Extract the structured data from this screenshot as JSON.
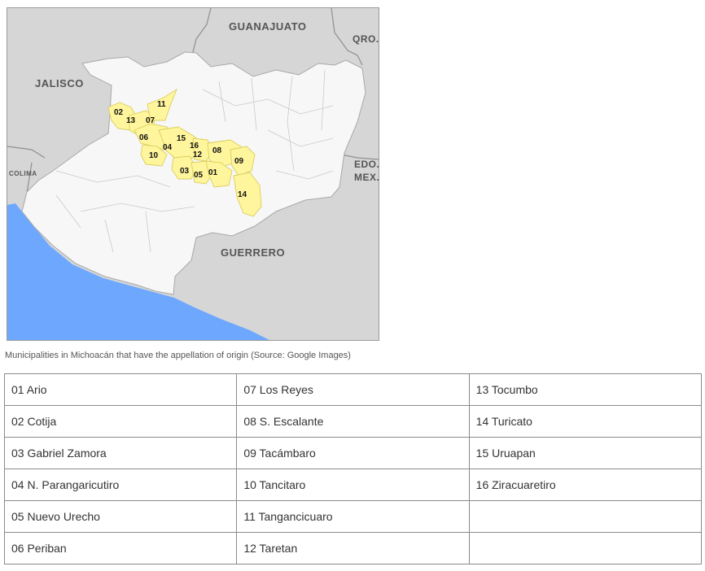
{
  "map": {
    "colors": {
      "ocean": "#6ea8fe",
      "neighbors": "#d6d6d6",
      "state": "#f7f7f7",
      "highlight": "#fff59d",
      "border": "#b8b8b8"
    },
    "regions": {
      "guanajuato": "GUANAJUATO",
      "queretaro": "QRO.",
      "jalisco": "JALISCO",
      "colima": "COLIMA",
      "edo_mex_line1": "EDO.",
      "edo_mex_line2": "MEX.",
      "guerrero": "GUERRERO"
    },
    "labels": [
      "01",
      "02",
      "03",
      "04",
      "05",
      "06",
      "07",
      "08",
      "09",
      "10",
      "11",
      "12",
      "13",
      "14",
      "15",
      "16"
    ]
  },
  "caption": "Municipalities in Michoacán that have the appellation of origin (Source: Google Images)",
  "table": {
    "rows": [
      [
        "01 Ario",
        "07 Los Reyes",
        "13 Tocumbo"
      ],
      [
        "02 Cotija",
        "08 S. Escalante",
        "14 Turicato"
      ],
      [
        "03 Gabriel Zamora",
        "09 Tacámbaro",
        "15 Uruapan"
      ],
      [
        "04 N. Parangaricutiro",
        "10 Tancitaro",
        "16 Ziracuaretiro"
      ],
      [
        "05 Nuevo Urecho",
        "11 Tangancicuaro",
        ""
      ],
      [
        "06 Periban",
        "12 Taretan",
        ""
      ]
    ]
  }
}
